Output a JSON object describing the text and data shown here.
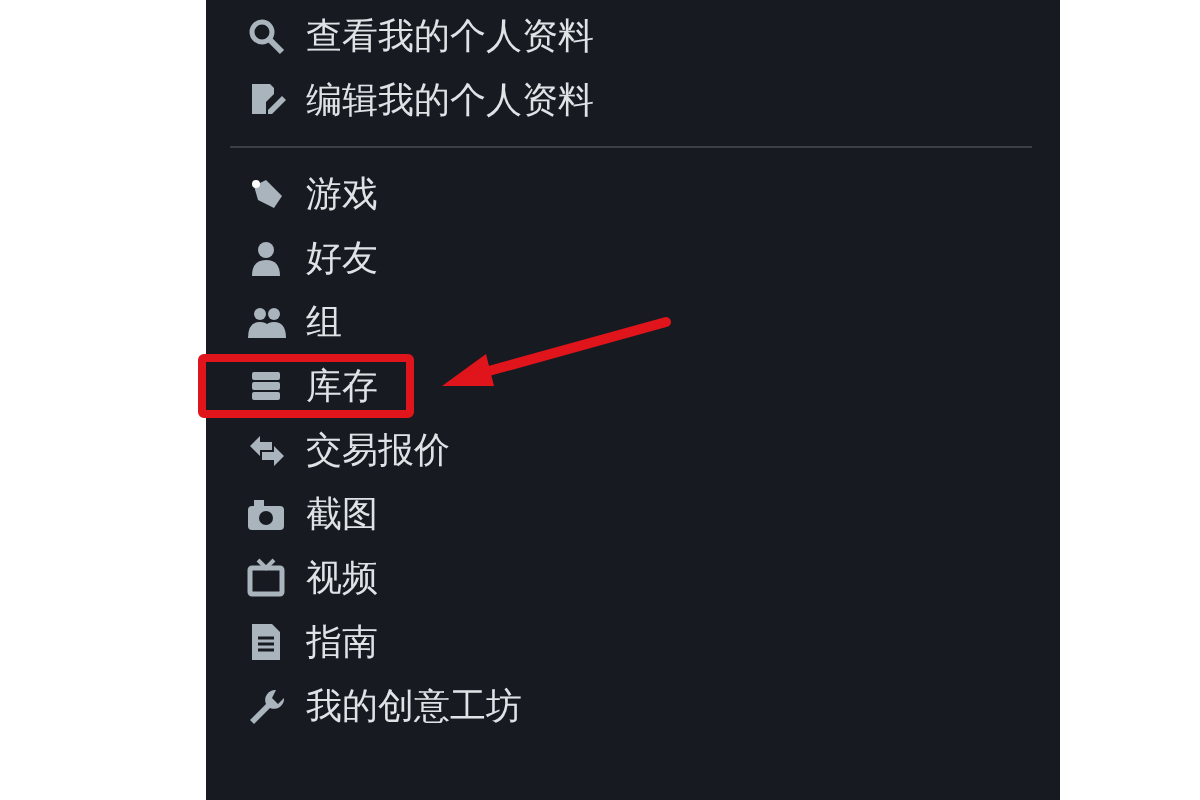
{
  "menu": {
    "sections": [
      {
        "items": [
          {
            "label": "查看我的个人资料",
            "highlighted": false
          },
          {
            "label": "编辑我的个人资料",
            "highlighted": false
          }
        ]
      },
      {
        "items": [
          {
            "label": "游戏",
            "highlighted": false
          },
          {
            "label": "好友",
            "highlighted": false
          },
          {
            "label": "组",
            "highlighted": false
          },
          {
            "label": "库存",
            "highlighted": true
          },
          {
            "label": "交易报价",
            "highlighted": false
          },
          {
            "label": "截图",
            "highlighted": false
          },
          {
            "label": "视频",
            "highlighted": false
          },
          {
            "label": "指南",
            "highlighted": false
          },
          {
            "label": "我的创意工坊",
            "highlighted": false
          }
        ]
      }
    ]
  }
}
